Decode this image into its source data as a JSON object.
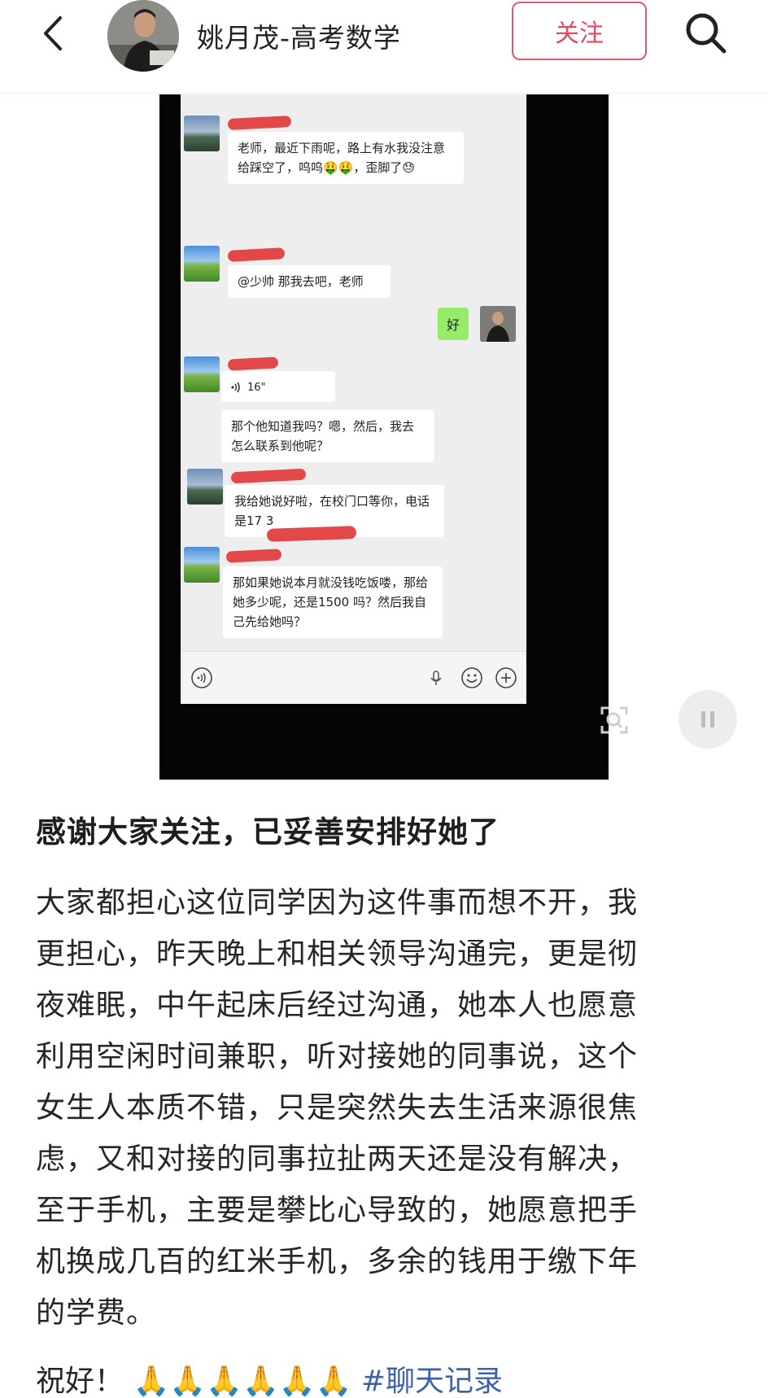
{
  "header": {
    "author_name": "姚月茂-高考数学",
    "follow_label": "关注"
  },
  "chat": {
    "messages": [
      {
        "from": "student",
        "text": "老师，最近下雨呢，路上有水我没注意给踩空了，呜呜🤑🤑，歪脚了😓"
      },
      {
        "from": "student",
        "text": "@少帅  那我去吧，老师"
      },
      {
        "from": "teacher",
        "text": "好"
      },
      {
        "from": "student",
        "voice": "16\""
      },
      {
        "from": "student",
        "text": "那个他知道我吗？嗯，然后，我去怎么联系到他呢？"
      },
      {
        "from": "teacher2",
        "text": "我给她说好啦，在校门口等你，电话是17        3"
      },
      {
        "from": "student",
        "text": "那如果她说本月就没钱吃饭喽，那给她多少呢，还是1500 吗？然后我自己先给她吗？"
      }
    ]
  },
  "post": {
    "title": "感谢大家关注，已妥善安排好她了",
    "body_lines": [
      "大家都担心这位同学因为这件事而想不开，我",
      "更担心，昨天晚上和相关领导沟通完，更是彻",
      "夜难眠，中午起床后经过沟通，她本人也愿意",
      "利用空闲时间兼职，听对接她的同事说，这个",
      "女生人本质不错，只是突然失去生活来源很焦",
      "虑，又和对接的同事拉扯两天还是没有解决，",
      "至于手机，主要是攀比心导致的，她愿意把手",
      "机换成几百的红米手机，多余的钱用于缴下年",
      "的学费。"
    ],
    "closing": "祝好！",
    "emoji": "🙏🙏🙏🙏🙏🙏",
    "hashtag": "#聊天记录"
  }
}
